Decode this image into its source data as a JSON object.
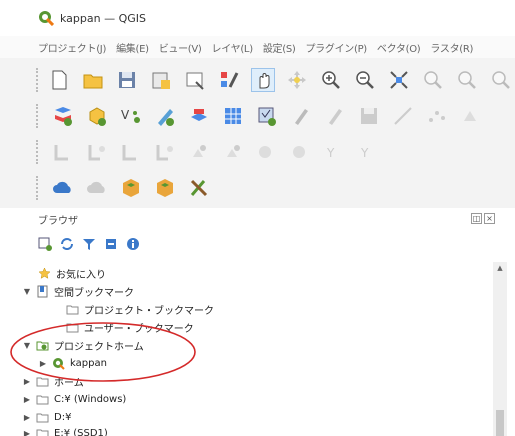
{
  "window": {
    "title": "kappan — QGIS"
  },
  "menu": [
    "プロジェクト(J)",
    "編集(E)",
    "ビュー(V)",
    "レイヤ(L)",
    "設定(S)",
    "プラグイン(P)",
    "ベクタ(O)",
    "ラスタ(R)"
  ],
  "toolbar_icons": {
    "row1": [
      "new-project-icon",
      "open-project-icon",
      "save-project-icon",
      "new-print-layout-icon",
      "layout-manager-icon",
      "style-manager-icon",
      "pan-map-icon",
      "pan-to-selection-icon",
      "zoom-in-icon",
      "zoom-out-icon",
      "zoom-full-icon",
      "zoom-to-selection-icon",
      "zoom-to-layer-icon",
      "zoom-native-icon"
    ],
    "row2": [
      "data-source-manager-icon",
      "new-geopackage-layer-icon",
      "new-shapefile-layer-icon",
      "new-spatialite-layer-icon",
      "new-virtual-layer-icon",
      "new-mesh-layer-icon",
      "add-csv-layer-icon",
      "toggle-editing-icon",
      "current-edits-icon",
      "save-edits-icon",
      "digitize-line-icon",
      "vertex-tool-icon",
      "delete-feature-icon"
    ],
    "row3": [
      "label-tool-icon",
      "pin-labels-icon",
      "highlight-labels-icon",
      "show-hide-labels-icon",
      "move-label-icon",
      "rotate-label-icon",
      "change-label-icon",
      "label-properties-icon",
      "diagram-tool-icon",
      "diagram-move-icon"
    ],
    "row4": [
      "cloud-icon",
      "cloud-disabled-icon",
      "plugin-box-icon",
      "plugin-box2-icon",
      "tools-icon"
    ]
  },
  "browser_panel": {
    "title": "ブラウザ",
    "buttons": [
      "add-selected-icon",
      "refresh-icon",
      "filter-icon",
      "collapse-all-icon",
      "info-icon"
    ],
    "tree": [
      {
        "label": "お気に入り",
        "icon": "favorites-star-icon",
        "level": 0,
        "expanded": null
      },
      {
        "label": "空間ブックマーク",
        "icon": "spatial-bookmarks-icon",
        "level": 0,
        "expanded": true
      },
      {
        "label": "プロジェクト・ブックマーク",
        "icon": "folder-icon",
        "level": 1,
        "expanded": null
      },
      {
        "label": "ユーザー・ブックマーク",
        "icon": "folder-icon",
        "level": 1,
        "expanded": null
      },
      {
        "label": "プロジェクトホーム",
        "icon": "project-home-icon",
        "level": 0,
        "expanded": true
      },
      {
        "label": "kappan",
        "icon": "qgis-project-icon",
        "level": 1,
        "expanded": false
      },
      {
        "label": "ホーム",
        "icon": "home-folder-icon",
        "level": 0,
        "expanded": false
      },
      {
        "label": "C:¥ (Windows)",
        "icon": "drive-icon",
        "level": 0,
        "expanded": false
      },
      {
        "label": "D:¥",
        "icon": "drive-icon",
        "level": 0,
        "expanded": false
      },
      {
        "label": "E:¥ (SSD1)",
        "icon": "drive-icon",
        "level": 0,
        "expanded": false
      }
    ]
  },
  "colors": {
    "highlight_ring": "#d42a2a",
    "qgis_green": "#589632",
    "folder_gray": "#8a8a8a"
  }
}
